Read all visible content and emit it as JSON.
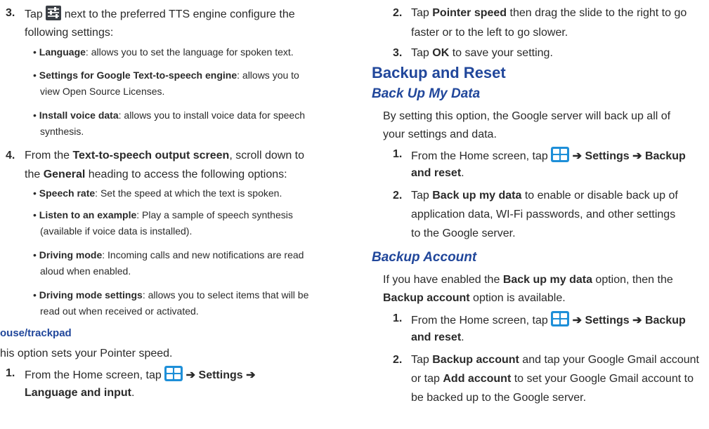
{
  "left": {
    "step3": {
      "num": "3.",
      "pre": "Tap",
      "post": "next to the preferred TTS engine configure the",
      "cont": "following settings:",
      "bullets": [
        {
          "label": "Language",
          "text": ": allows you to set the language for spoken text."
        },
        {
          "label": "Settings for Google Text-to-speech engine",
          "text": ": allows you to",
          "cont": "view Open Source Licenses."
        },
        {
          "label": "Install voice data",
          "text": ": allows you to install voice data for speech",
          "cont": "synthesis."
        }
      ]
    },
    "step4": {
      "num": "4.",
      "pre": "From the",
      "bold1": "Text-to-speech output screen",
      "post": ", scroll down to",
      "cont_pre": "the",
      "bold2": "General",
      "cont_post": "heading to access the following options:",
      "bullets": [
        {
          "label": "Speech rate",
          "text": ": Set the speed at which the text is spoken."
        },
        {
          "label": "Listen to an example",
          "text": ": Play a sample of speech synthesis",
          "cont": "(available if voice data is installed)."
        },
        {
          "label": "Driving mode",
          "text": ": Incoming calls and new notifications are read",
          "cont": "aloud when enabled."
        },
        {
          "label": "Driving mode settings",
          "text": ": allows you to select items that will be",
          "cont": "read out when received or activated."
        }
      ]
    },
    "mouse_heading": "ouse/trackpad",
    "mouse_intro": "his option sets your Pointer speed.",
    "step1": {
      "num": "1.",
      "pre": "From the Home screen, tap",
      "arrow1": "➔",
      "settings": "Settings",
      "arrow2": "➔",
      "lang": "Language and input",
      "period": "."
    }
  },
  "right": {
    "step2": {
      "num": "2.",
      "pre": "Tap",
      "bold": "Pointer speed",
      "post": "then drag the slide to the right to go",
      "cont": "faster or to the left to go slower."
    },
    "step3": {
      "num": "3.",
      "pre": "Tap",
      "bold": "OK",
      "post": "to save your setting."
    },
    "section_title": "Backup and Reset",
    "backup_my_data": {
      "title": "Back Up My Data",
      "intro1": "By setting this option, the Google server will back up all of",
      "intro2": "your settings and data.",
      "s1": {
        "num": "1.",
        "pre": "From the Home screen, tap",
        "arrow1": "➔",
        "settings": "Settings",
        "arrow2": "➔",
        "backup": "Backup",
        "cont": "and reset",
        "period": "."
      },
      "s2": {
        "num": "2.",
        "pre": "Tap",
        "bold": "Back up my data",
        "post": "to enable or disable back up of",
        "cont1": "application data, WI-Fi passwords, and other settings",
        "cont2": "to the Google server."
      }
    },
    "backup_account": {
      "title": "Backup Account",
      "intro_pre": "If you have enabled the",
      "intro_bold": "Back up my data",
      "intro_post": "option, then the",
      "intro2_bold": "Backup account",
      "intro2_post": "option is available.",
      "s1": {
        "num": "1.",
        "pre": "From the Home screen, tap",
        "arrow1": "➔",
        "settings": "Settings",
        "arrow2": "➔",
        "backup": "Backup",
        "cont": "and reset",
        "period": "."
      },
      "s2": {
        "num": "2.",
        "pre": "Tap",
        "bold1": "Backup account",
        "post1": "and tap your Google Gmail account",
        "cont_pre": "or tap",
        "bold2": "Add account",
        "cont_post": "to set your Google Gmail account to",
        "cont2": "be backed up to the Google server."
      }
    }
  },
  "icons": {
    "apps": "apps-grid-icon",
    "tune": "settings-sliders-icon"
  },
  "colors": {
    "heading": "#21479b",
    "apps_icon": "#1e8fd8"
  }
}
